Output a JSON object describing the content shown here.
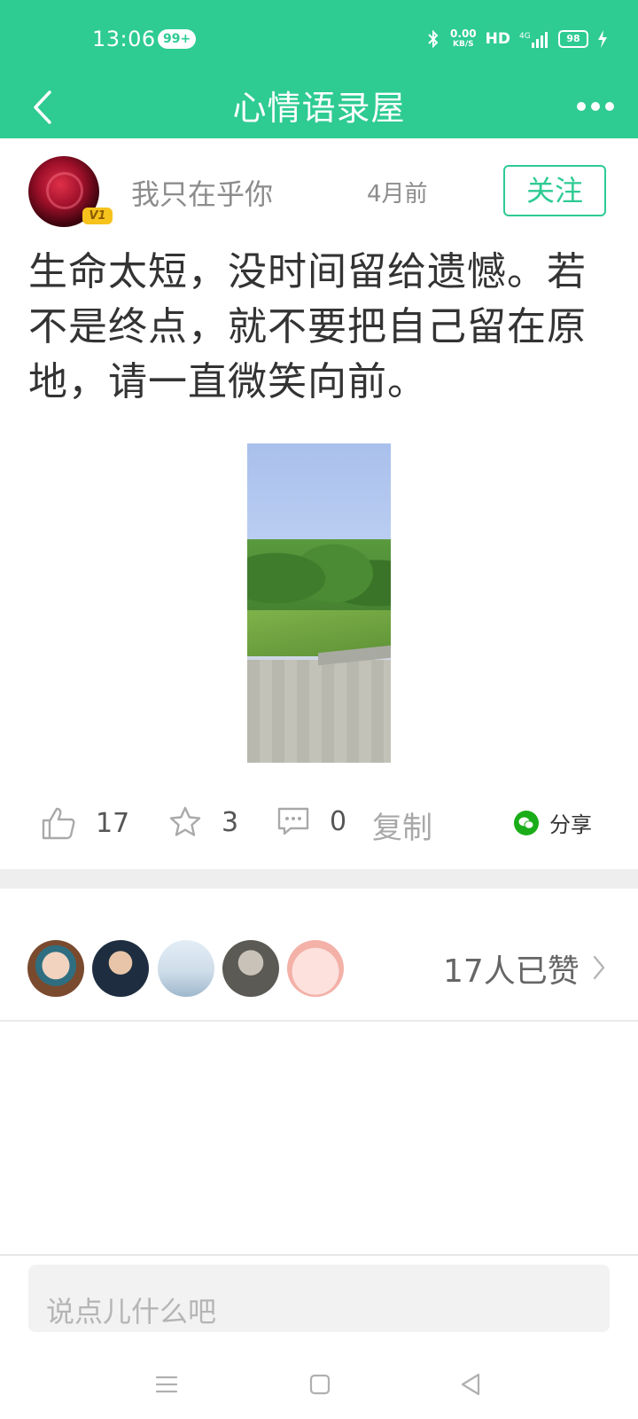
{
  "status_bar": {
    "time": "13:06",
    "notification_badge": "99+",
    "net_speed_value": "0.00",
    "net_speed_unit": "KB/S",
    "hd_label": "HD",
    "network_type": "4G",
    "battery": "98"
  },
  "header": {
    "title": "心情语录屋",
    "back_icon": "chevron-left-icon",
    "more_icon": "more-dots-icon"
  },
  "post": {
    "author": "我只在乎你",
    "level": "V1",
    "time": "4月前",
    "follow_label": "关注",
    "text": "生命太短，没时间留给遗憾。若不是终点，就不要把自己留在原地，请一直微笑向前。"
  },
  "actions": {
    "likes": "17",
    "favorites": "3",
    "comments": "0",
    "copy_label": "复制",
    "share_label": "分享"
  },
  "likers": {
    "count_label": "17人已赞",
    "avatars": [
      "avatar-1",
      "avatar-2",
      "avatar-3",
      "avatar-4",
      "avatar-5"
    ]
  },
  "comment_bar": {
    "placeholder": "说点儿什么吧"
  },
  "colors": {
    "brand": "#2ecb93",
    "wechat": "#1aad19"
  }
}
